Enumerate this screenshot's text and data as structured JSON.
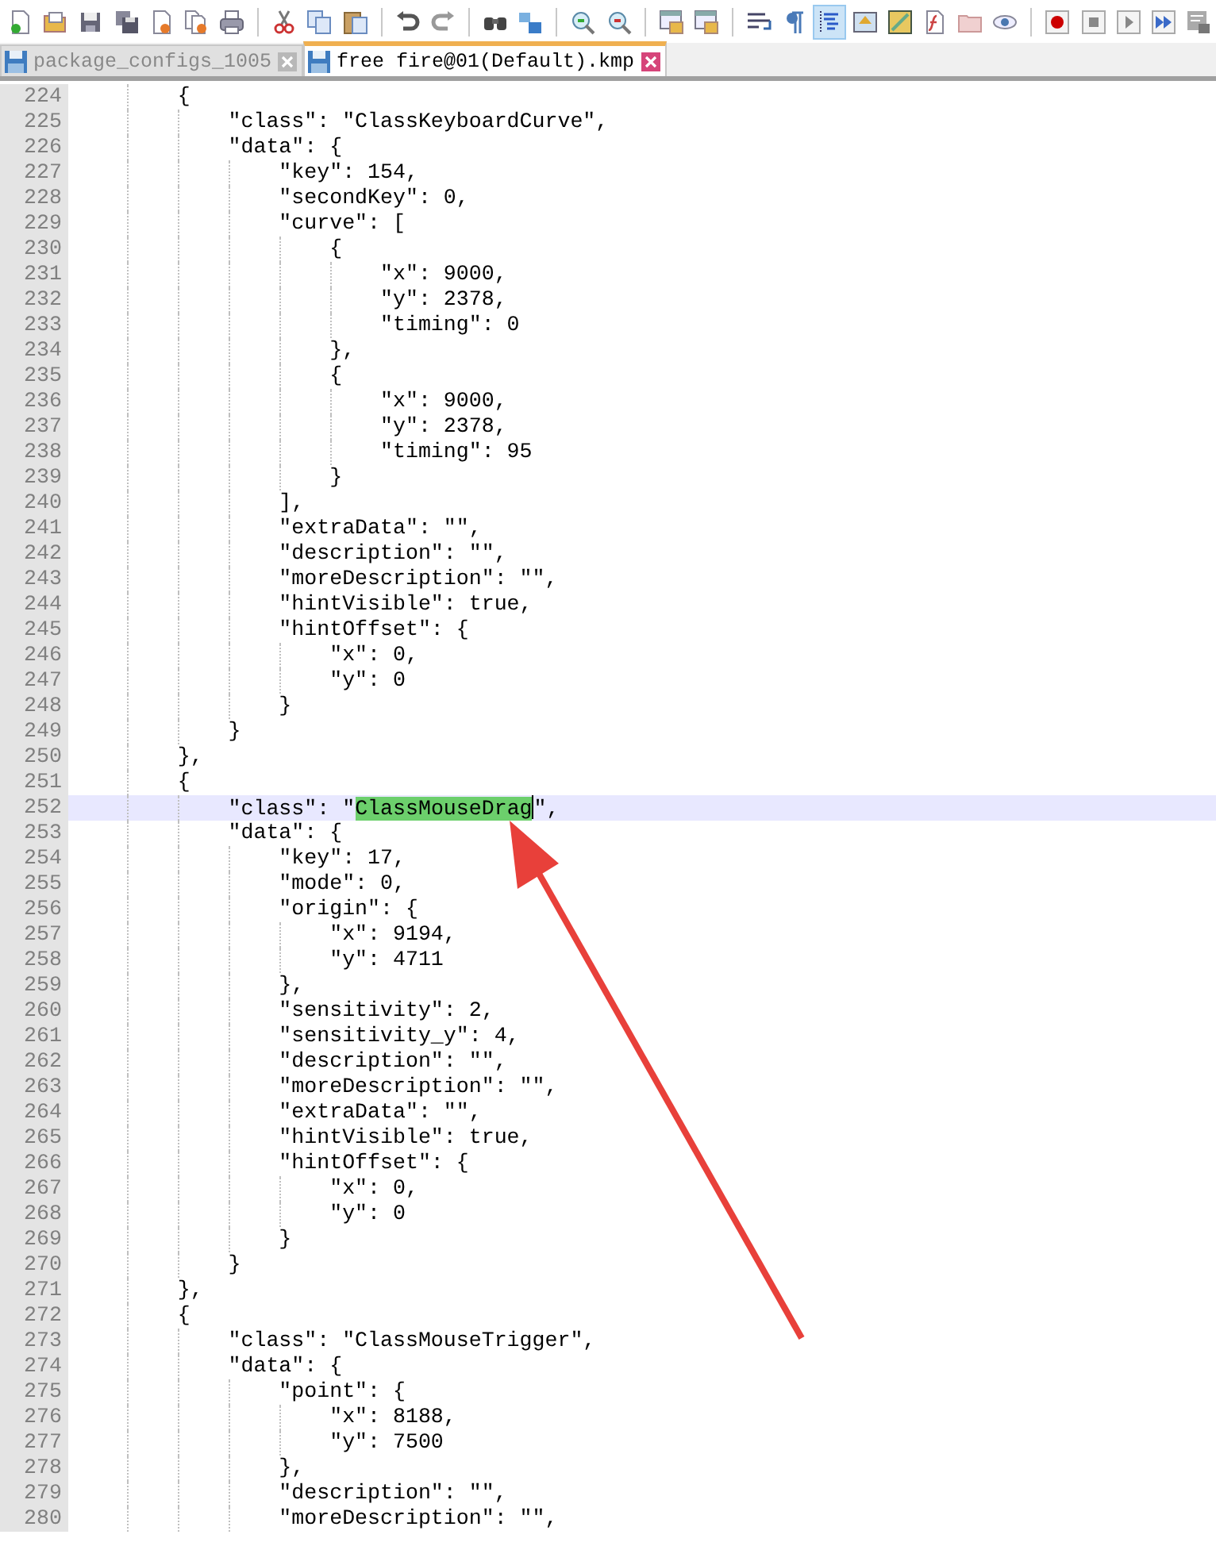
{
  "toolbar": [
    {
      "kind": "new",
      "selected": false
    },
    {
      "kind": "open",
      "selected": false
    },
    {
      "kind": "save",
      "selected": false
    },
    {
      "kind": "save-all",
      "selected": false
    },
    {
      "kind": "close",
      "selected": false
    },
    {
      "kind": "close-all",
      "selected": false
    },
    {
      "kind": "print",
      "selected": false
    },
    {
      "kind": "separator"
    },
    {
      "kind": "cut",
      "selected": false
    },
    {
      "kind": "copy",
      "selected": false
    },
    {
      "kind": "paste",
      "selected": false
    },
    {
      "kind": "separator"
    },
    {
      "kind": "undo",
      "selected": false
    },
    {
      "kind": "redo",
      "selected": false
    },
    {
      "kind": "separator"
    },
    {
      "kind": "find",
      "selected": false
    },
    {
      "kind": "replace",
      "selected": false
    },
    {
      "kind": "separator"
    },
    {
      "kind": "zoom-in",
      "selected": false
    },
    {
      "kind": "zoom-out",
      "selected": false
    },
    {
      "kind": "separator"
    },
    {
      "kind": "sync-vertical",
      "selected": false
    },
    {
      "kind": "sync-horizontal",
      "selected": false
    },
    {
      "kind": "separator"
    },
    {
      "kind": "wrap",
      "selected": false
    },
    {
      "kind": "pilcrow",
      "selected": false
    },
    {
      "kind": "indent-guide",
      "selected": true
    },
    {
      "kind": "language",
      "selected": false
    },
    {
      "kind": "doc-map",
      "selected": false
    },
    {
      "kind": "function-list",
      "selected": false
    },
    {
      "kind": "folder",
      "selected": false
    },
    {
      "kind": "monitor",
      "selected": false
    },
    {
      "kind": "separator"
    },
    {
      "kind": "record",
      "selected": false
    },
    {
      "kind": "stop",
      "selected": false
    },
    {
      "kind": "play",
      "selected": false
    },
    {
      "kind": "play-multiple",
      "selected": false
    },
    {
      "kind": "save-macro",
      "selected": false
    }
  ],
  "tabs": [
    {
      "label": "package_configs_1005",
      "selected": false
    },
    {
      "label": "free fire@01(Default).kmp",
      "selected": true
    }
  ],
  "lines": [
    {
      "number": "224",
      "current": false,
      "text": "        {"
    },
    {
      "number": "225",
      "current": false,
      "text": "            \"class\": \"ClassKeyboardCurve\","
    },
    {
      "number": "226",
      "current": false,
      "text": "            \"data\": {"
    },
    {
      "number": "227",
      "current": false,
      "text": "                \"key\": 154,"
    },
    {
      "number": "228",
      "current": false,
      "text": "                \"secondKey\": 0,"
    },
    {
      "number": "229",
      "current": false,
      "text": "                \"curve\": ["
    },
    {
      "number": "230",
      "current": false,
      "text": "                    {"
    },
    {
      "number": "231",
      "current": false,
      "text": "                        \"x\": 9000,"
    },
    {
      "number": "232",
      "current": false,
      "text": "                        \"y\": 2378,"
    },
    {
      "number": "233",
      "current": false,
      "text": "                        \"timing\": 0"
    },
    {
      "number": "234",
      "current": false,
      "text": "                    },"
    },
    {
      "number": "235",
      "current": false,
      "text": "                    {"
    },
    {
      "number": "236",
      "current": false,
      "text": "                        \"x\": 9000,"
    },
    {
      "number": "237",
      "current": false,
      "text": "                        \"y\": 2378,"
    },
    {
      "number": "238",
      "current": false,
      "text": "                        \"timing\": 95"
    },
    {
      "number": "239",
      "current": false,
      "text": "                    }"
    },
    {
      "number": "240",
      "current": false,
      "text": "                ],"
    },
    {
      "number": "241",
      "current": false,
      "text": "                \"extraData\": \"\","
    },
    {
      "number": "242",
      "current": false,
      "text": "                \"description\": \"\","
    },
    {
      "number": "243",
      "current": false,
      "text": "                \"moreDescription\": \"\","
    },
    {
      "number": "244",
      "current": false,
      "text": "                \"hintVisible\": true,"
    },
    {
      "number": "245",
      "current": false,
      "text": "                \"hintOffset\": {"
    },
    {
      "number": "246",
      "current": false,
      "text": "                    \"x\": 0,"
    },
    {
      "number": "247",
      "current": false,
      "text": "                    \"y\": 0"
    },
    {
      "number": "248",
      "current": false,
      "text": "                }"
    },
    {
      "number": "249",
      "current": false,
      "text": "            }"
    },
    {
      "number": "250",
      "current": false,
      "text": "        },"
    },
    {
      "number": "251",
      "current": false,
      "text": "        {"
    },
    {
      "number": "252",
      "current": true,
      "segments": [
        {
          "text": "            \"class\": \"",
          "selected": false
        },
        {
          "text": "ClassMouseDrag",
          "selected": true
        },
        {
          "text": "\",",
          "selected": false
        }
      ]
    },
    {
      "number": "253",
      "current": false,
      "text": "            \"data\": {"
    },
    {
      "number": "254",
      "current": false,
      "text": "                \"key\": 17,"
    },
    {
      "number": "255",
      "current": false,
      "text": "                \"mode\": 0,"
    },
    {
      "number": "256",
      "current": false,
      "text": "                \"origin\": {"
    },
    {
      "number": "257",
      "current": false,
      "text": "                    \"x\": 9194,"
    },
    {
      "number": "258",
      "current": false,
      "text": "                    \"y\": 4711"
    },
    {
      "number": "259",
      "current": false,
      "text": "                },"
    },
    {
      "number": "260",
      "current": false,
      "text": "                \"sensitivity\": 2,"
    },
    {
      "number": "261",
      "current": false,
      "text": "                \"sensitivity_y\": 4,"
    },
    {
      "number": "262",
      "current": false,
      "text": "                \"description\": \"\","
    },
    {
      "number": "263",
      "current": false,
      "text": "                \"moreDescription\": \"\","
    },
    {
      "number": "264",
      "current": false,
      "text": "                \"extraData\": \"\","
    },
    {
      "number": "265",
      "current": false,
      "text": "                \"hintVisible\": true,"
    },
    {
      "number": "266",
      "current": false,
      "text": "                \"hintOffset\": {"
    },
    {
      "number": "267",
      "current": false,
      "text": "                    \"x\": 0,"
    },
    {
      "number": "268",
      "current": false,
      "text": "                    \"y\": 0"
    },
    {
      "number": "269",
      "current": false,
      "text": "                }"
    },
    {
      "number": "270",
      "current": false,
      "text": "            }"
    },
    {
      "number": "271",
      "current": false,
      "text": "        },"
    },
    {
      "number": "272",
      "current": false,
      "text": "        {"
    },
    {
      "number": "273",
      "current": false,
      "text": "            \"class\": \"ClassMouseTrigger\","
    },
    {
      "number": "274",
      "current": false,
      "text": "            \"data\": {"
    },
    {
      "number": "275",
      "current": false,
      "text": "                \"point\": {"
    },
    {
      "number": "276",
      "current": false,
      "text": "                    \"x\": 8188,"
    },
    {
      "number": "277",
      "current": false,
      "text": "                    \"y\": 7500"
    },
    {
      "number": "278",
      "current": false,
      "text": "                },"
    },
    {
      "number": "279",
      "current": false,
      "text": "                \"description\": \"\","
    },
    {
      "number": "280",
      "current": false,
      "text": "                \"moreDescription\": \"\","
    }
  ]
}
